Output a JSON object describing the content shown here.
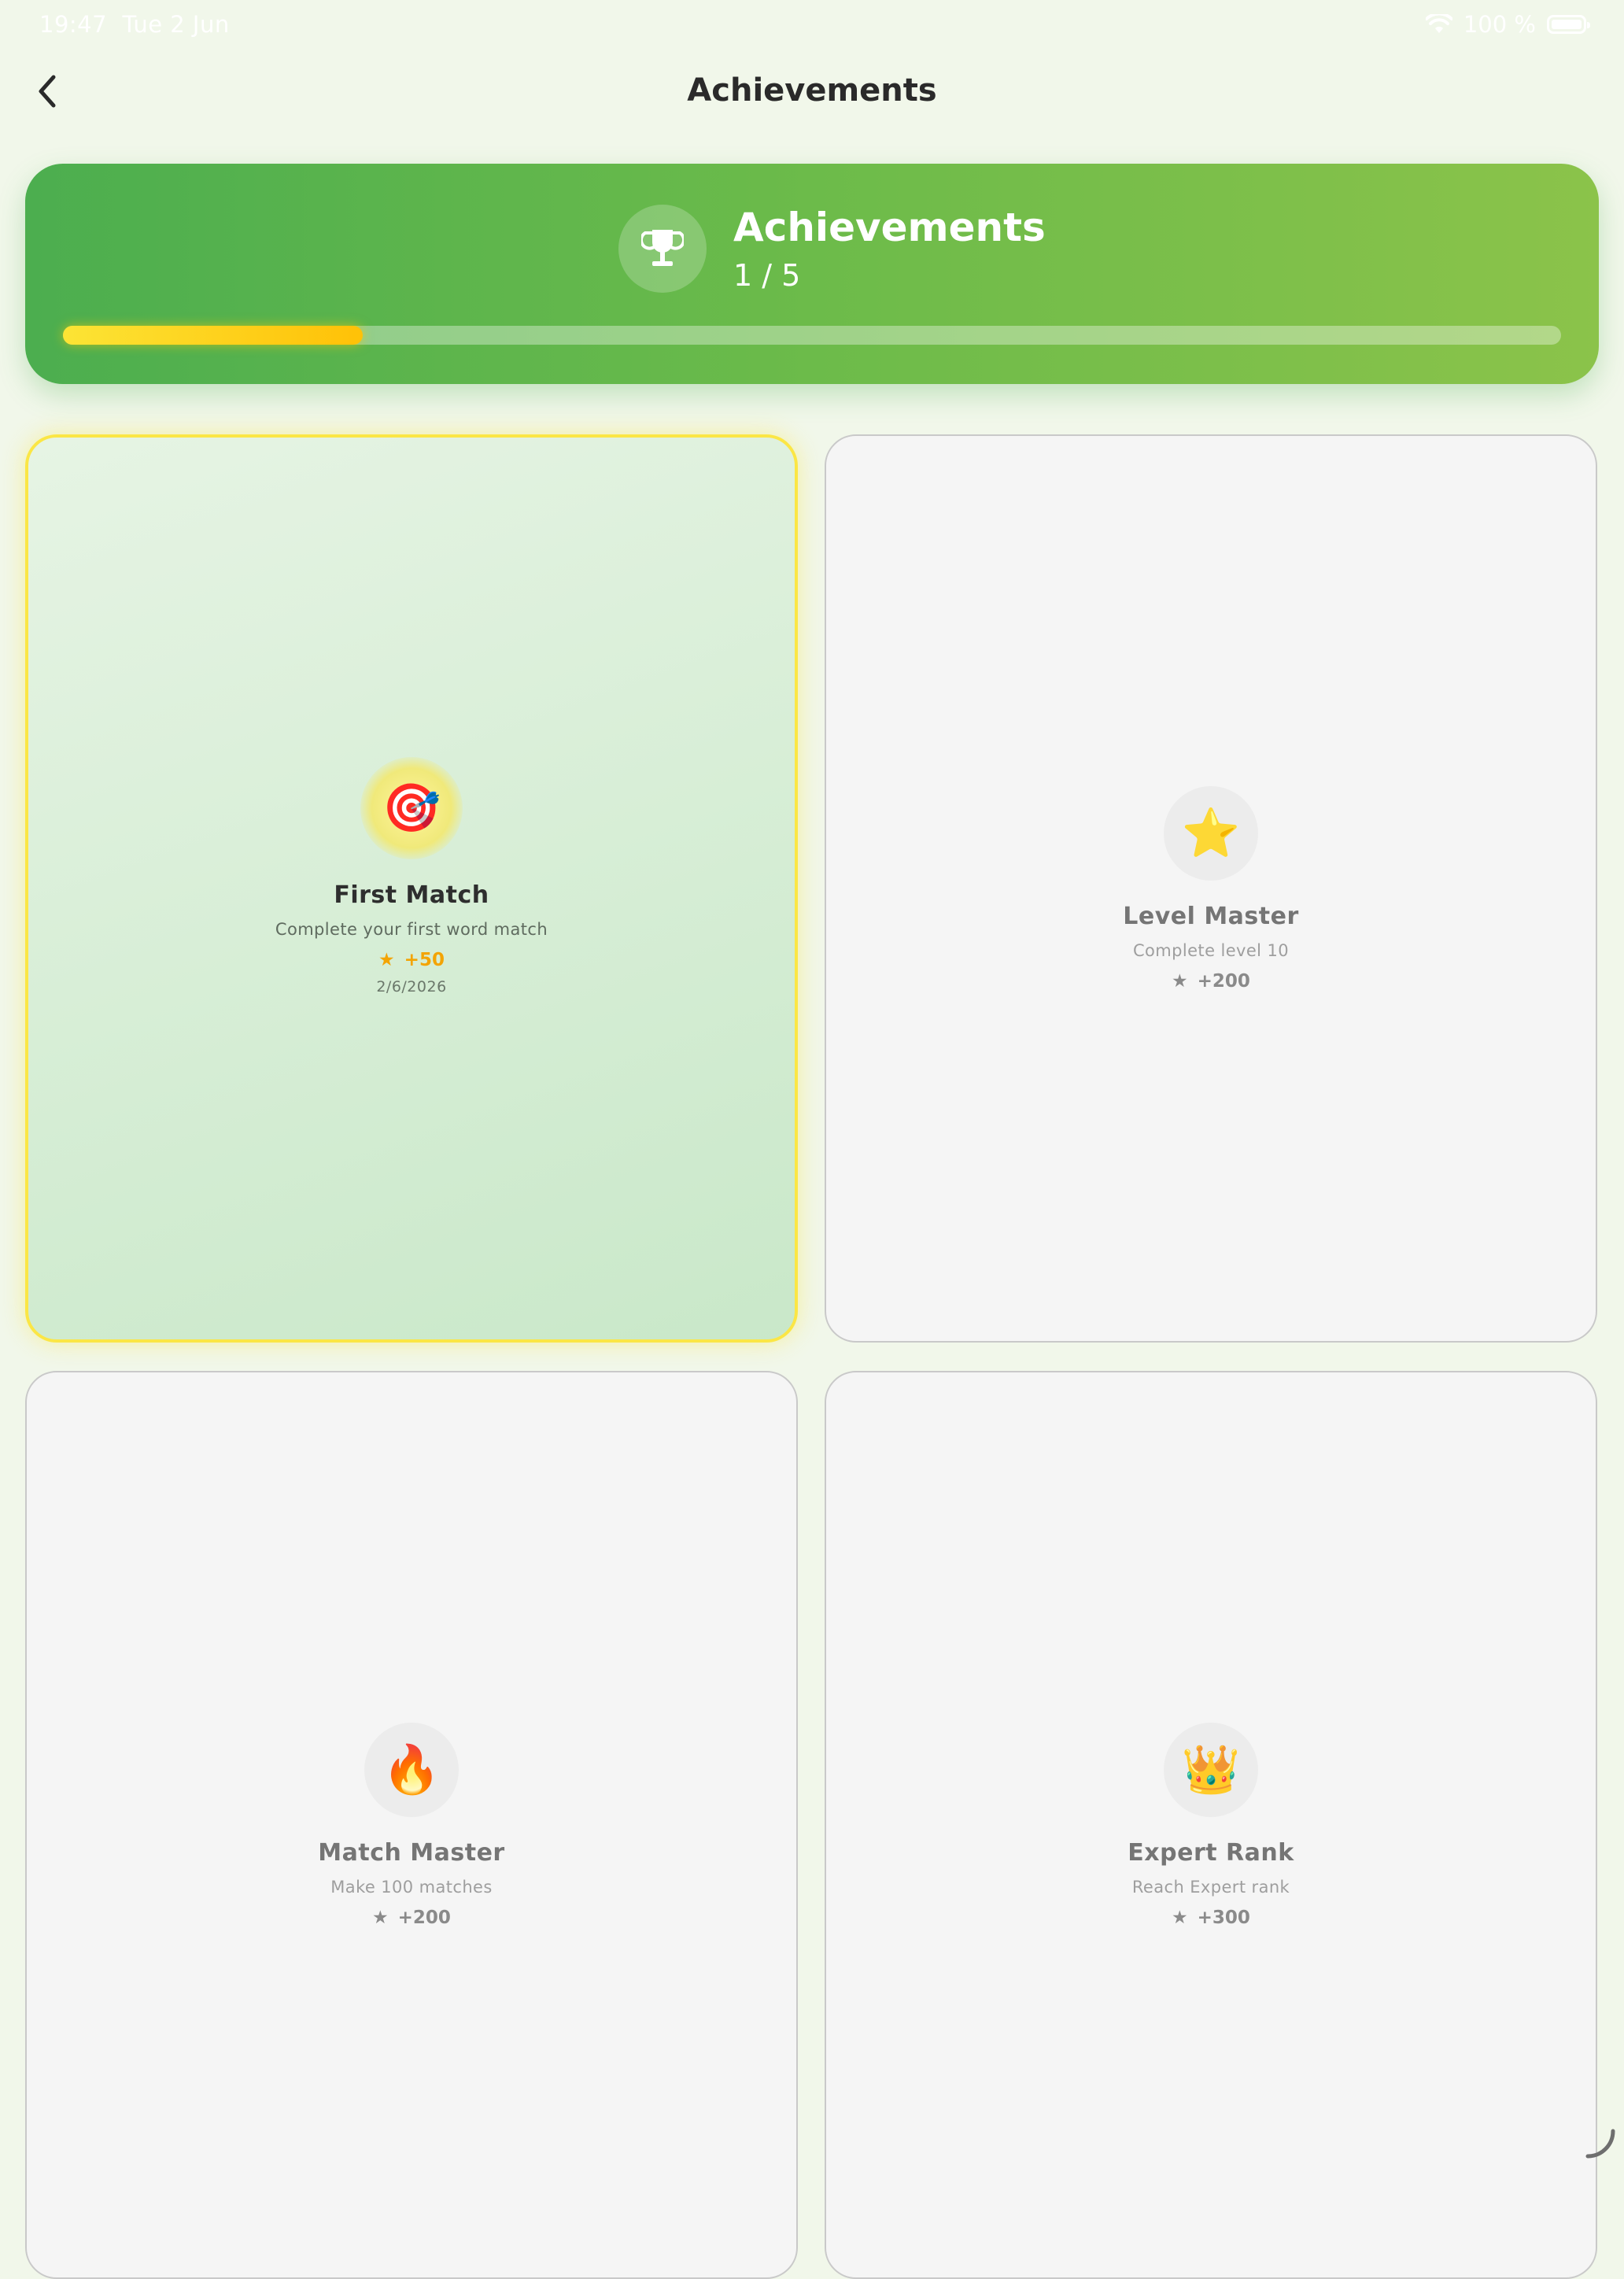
{
  "status_bar": {
    "time": "19:47",
    "date": "Tue 2 Jun",
    "battery": "100 %",
    "battery_level": 1.0
  },
  "nav": {
    "title": "Achievements"
  },
  "summary": {
    "title": "Achievements",
    "count": "1 / 5",
    "progress": 0.2
  },
  "achievements": [
    {
      "title": "First Match",
      "description": "Complete your first word match",
      "points": "+50",
      "date": "2/6/2026",
      "icon": "🎯",
      "icon_name": "target-icon",
      "unlocked": true
    },
    {
      "title": "Level Master",
      "description": "Complete level 10",
      "points": "+200",
      "icon": "⭐",
      "icon_name": "star-icon",
      "unlocked": false
    },
    {
      "title": "Match Master",
      "description": "Make 100 matches",
      "points": "+200",
      "icon": "🔥",
      "icon_name": "fire-icon",
      "unlocked": false
    },
    {
      "title": "Expert Rank",
      "description": "Reach Expert rank",
      "points": "+300",
      "icon": "👑",
      "icon_name": "crown-icon",
      "unlocked": false
    }
  ],
  "colors": {
    "accent_start": "#4cae4f",
    "accent_end": "#8bc34a",
    "progress": "#ffc107",
    "unlocked_border": "#fbe645",
    "points_unlocked": "#f3a405"
  }
}
